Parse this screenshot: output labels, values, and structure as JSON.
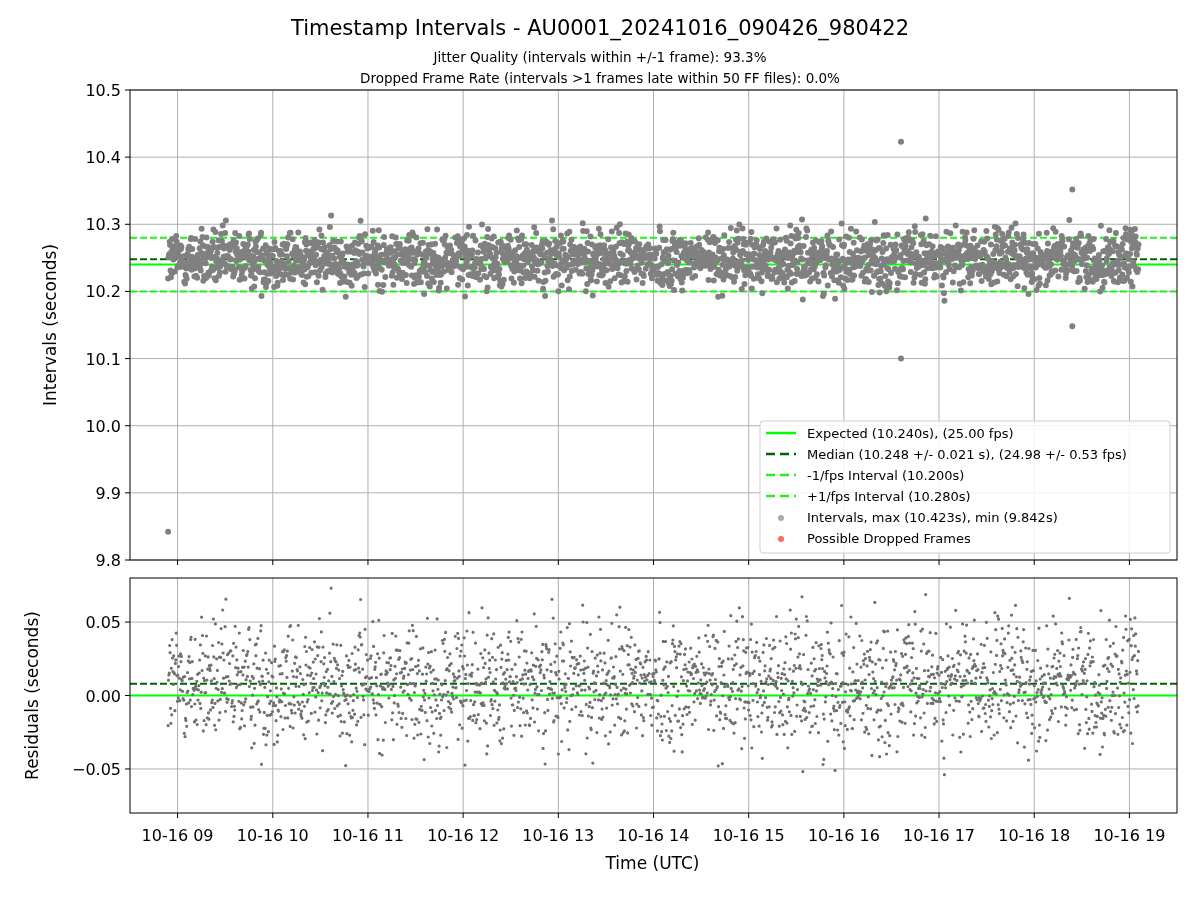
{
  "figure": {
    "title": "Timestamp Intervals - AU0001_20241016_090426_980422",
    "subtitle": [
      "Jitter Quality (intervals within +/-1 frame): 93.3%",
      "Dropped Frame Rate (intervals >1 frames late within 50 FF files): 0.0%"
    ]
  },
  "intervals_plot": {
    "chart_data": {
      "type": "scatter",
      "ylabel": "Intervals (seconds)",
      "grid": true,
      "legend": "lower right",
      "ylim": [
        9.8,
        10.5
      ],
      "categories": [
        null,
        null,
        null,
        null,
        null,
        null,
        null,
        null,
        null,
        null,
        null
      ],
      "yticks": [
        {
          "value": 9.8,
          "label": "9.8"
        },
        {
          "value": 9.9,
          "label": "9.9"
        },
        {
          "value": 10.0,
          "label": "10.0"
        },
        {
          "value": 10.1,
          "label": "10.1"
        },
        {
          "value": 10.2,
          "label": "10.2"
        },
        {
          "value": 10.3,
          "label": "10.3"
        },
        {
          "value": 10.4,
          "label": "10.4"
        },
        {
          "value": 10.5,
          "label": "10.5"
        }
      ],
      "ref_lines": [
        {
          "axis": "y",
          "value": 10.24,
          "label": "Expected (10.240s), (25.00 fps)",
          "color": "#00ff00"
        },
        {
          "axis": "y",
          "value": 10.248,
          "label": "Median (10.248 +/- 0.021 s), (24.98 +/- 0.53 fps)",
          "color": "#006400"
        },
        {
          "axis": "y",
          "value": 10.2,
          "label": "-1/fps Interval (10.200s)",
          "color": "#22ee22"
        },
        {
          "axis": "y",
          "value": 10.28,
          "label": "+1/fps Interval (10.280s)",
          "color": "#22ee22"
        }
      ]
    },
    "legend_markers": [
      {
        "label": "Intervals, max (10.423s), min (9.842s)",
        "color": "#aaaaaa"
      },
      {
        "label": "Possible Dropped Frames",
        "color": "#ff6666"
      }
    ]
  },
  "residuals_plot": {
    "chart_data": {
      "type": "scatter",
      "xlabel": "Time (UTC)",
      "ylabel": "Residuals (seconds)",
      "grid": true,
      "ylim": [
        -0.08,
        0.08
      ],
      "categories": [
        "10-16 09",
        "10-16 10",
        "10-16 11",
        "10-16 12",
        "10-16 13",
        "10-16 14",
        "10-16 15",
        "10-16 16",
        "10-16 17",
        "10-16 18",
        "10-16 19"
      ],
      "yticks": [
        {
          "value": -0.05,
          "label": "−0.05"
        },
        {
          "value": 0,
          "label": "0.00"
        },
        {
          "value": 0.05,
          "label": "0.05"
        }
      ],
      "ref_lines": [
        {
          "axis": "y",
          "value": 0,
          "color": "#00ff00"
        },
        {
          "axis": "y",
          "value": 0.008,
          "color": "#006400"
        }
      ]
    }
  }
}
